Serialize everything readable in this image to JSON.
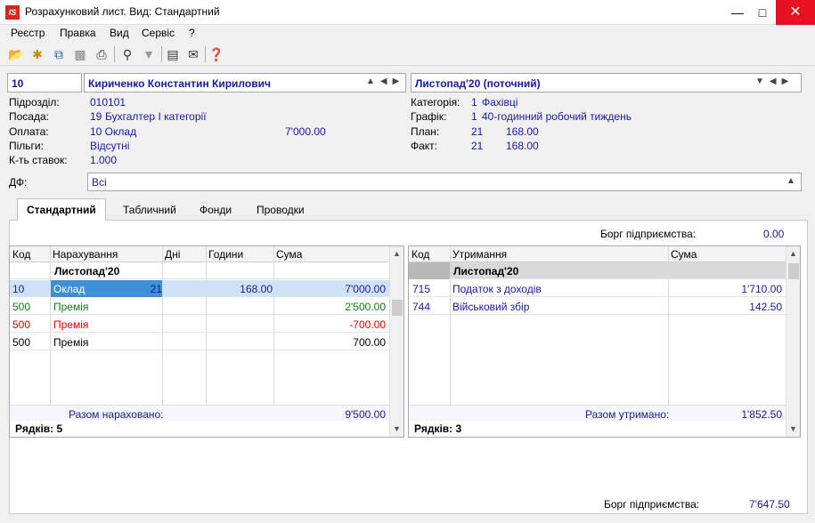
{
  "window": {
    "title": "Розрахунковий лист. Вид: Стандартний",
    "logo": "IS"
  },
  "menu": [
    "Реєстр",
    "Правка",
    "Вид",
    "Сервіс",
    "?"
  ],
  "header": {
    "emp_code": "10",
    "emp_name": "Кириченко Константин Кирилович",
    "period": "Листопад'20 (поточний)"
  },
  "info_left": {
    "podrozdil_label": "Підрозділ:",
    "podrozdil_value": "010101",
    "posada_label": "Посада:",
    "posada_code": "19",
    "posada_value": "Бухгалтер І категорії",
    "oplata_label": "Оплата:",
    "oplata_value": "10 Оклад",
    "oplata_amount": "7'000.00",
    "pilhy_label": "Пільги:",
    "pilhy_value": "Відсутні",
    "stavok_label": "К-ть ставок:",
    "stavok_value": "1.000"
  },
  "info_right": {
    "kategoria_label": "Категорія:",
    "kategoria_code": "1",
    "kategoria_value": "Фахівці",
    "grafik_label": "Графік:",
    "grafik_code": "1",
    "grafik_value": "40-годинний робочий тиждень",
    "plan_label": "План:",
    "plan_days": "21",
    "plan_hours": "168.00",
    "fakt_label": "Факт:",
    "fakt_days": "21",
    "fakt_hours": "168.00"
  },
  "df": {
    "label": "ДФ:",
    "value": "Всі"
  },
  "tabs": [
    "Стандартний",
    "Табличний",
    "Фонди",
    "Проводки"
  ],
  "debt_top": {
    "label": "Борг підприємства:",
    "value": "0.00"
  },
  "accruals": {
    "headers": [
      "Код",
      "Нарахування",
      "Дні",
      "Години",
      "Сума"
    ],
    "group": "Листопад'20",
    "rows": [
      {
        "code": "10",
        "name": "Оклад",
        "days": "21",
        "hours": "168.00",
        "sum": "7'000.00",
        "color": "#1a1a9c"
      },
      {
        "code": "500",
        "name": "Премія",
        "days": "",
        "hours": "",
        "sum": "2'500.00",
        "color": "#108010"
      },
      {
        "code": "500",
        "name": "Премія",
        "days": "",
        "hours": "",
        "sum": "-700.00",
        "color": "#e00000"
      },
      {
        "code": "500",
        "name": "Премія",
        "days": "",
        "hours": "",
        "sum": "700.00",
        "color": "#000000"
      }
    ],
    "total_label": "Разом нараховано:",
    "total_value": "9'500.00",
    "count_label": "Рядків: 5"
  },
  "deductions": {
    "headers": [
      "Код",
      "Утримання",
      "Сума"
    ],
    "group": "Листопад'20",
    "rows": [
      {
        "code": "715",
        "name": "Податок з доходів",
        "sum": "1'710.00"
      },
      {
        "code": "744",
        "name": "Військовий збір",
        "sum": "142.50"
      }
    ],
    "total_label": "Разом утримано:",
    "total_value": "1'852.50",
    "count_label": "Рядків: 3"
  },
  "debt_bottom": {
    "label": "Борг підприємства:",
    "value": "7'647.50"
  },
  "icons": {
    "toolbar": [
      "open-icon",
      "new-icon",
      "copy-icon",
      "paste-icon",
      "print-icon",
      "find-icon",
      "filter-icon",
      "form-icon",
      "mail-icon",
      "help-icon"
    ]
  }
}
